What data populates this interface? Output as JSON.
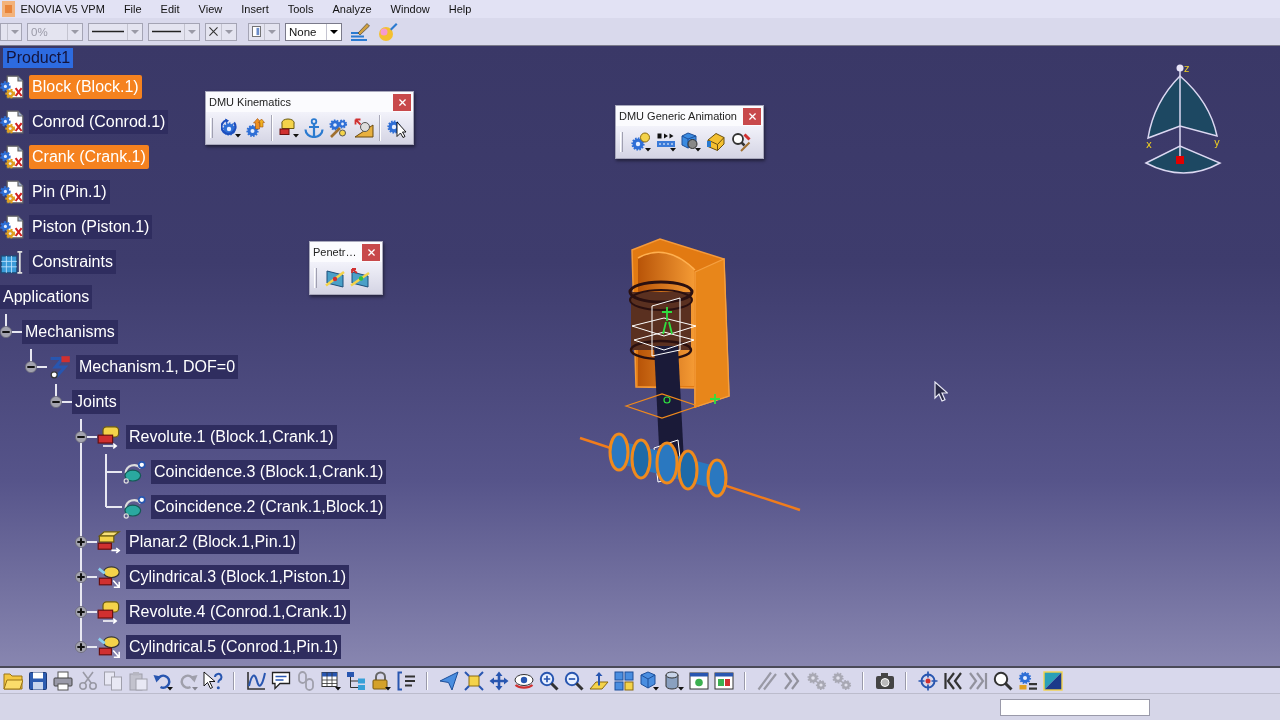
{
  "menu_bar": {
    "items": [
      "ENOVIA V5 VPM",
      "File",
      "Edit",
      "View",
      "Insert",
      "Tools",
      "Analyze",
      "Window",
      "Help"
    ]
  },
  "top_toolbar": {
    "dropdowns": [
      {
        "kind": "blank",
        "disabled": true
      },
      {
        "kind": "text",
        "value": "0%",
        "disabled": true
      },
      {
        "kind": "line",
        "disabled": true
      },
      {
        "kind": "line",
        "disabled": true
      },
      {
        "kind": "cross",
        "disabled": true
      },
      {
        "kind": "page",
        "disabled": true
      },
      {
        "kind": "text",
        "value": "None",
        "disabled": false
      }
    ]
  },
  "tree": {
    "root": {
      "label": "Product1",
      "active": true
    },
    "items": [
      {
        "label": "Block (Block.1)",
        "kind": "part",
        "selected": true
      },
      {
        "label": "Conrod (Conrod.1)",
        "kind": "part",
        "selected": false
      },
      {
        "label": "Crank (Crank.1)",
        "kind": "part",
        "selected": true
      },
      {
        "label": "Pin (Pin.1)",
        "kind": "part",
        "selected": false
      },
      {
        "label": "Piston (Piston.1)",
        "kind": "part",
        "selected": false
      },
      {
        "label": "Constraints",
        "kind": "constraints",
        "selected": false
      },
      {
        "label": "Applications",
        "selected": false,
        "children": [
          {
            "label": "Mechanisms",
            "selected": false,
            "expanded": true,
            "children": [
              {
                "label": "Mechanism.1, DOF=0",
                "kind": "mechanism",
                "selected": false,
                "expanded": true,
                "children": [
                  {
                    "label": "Joints",
                    "selected": false,
                    "expanded": true,
                    "children": [
                      {
                        "label": "Revolute.1 (Block.1,Crank.1)",
                        "kind": "revolute",
                        "selected": false,
                        "expanded": true,
                        "children": [
                          {
                            "label": "Coincidence.3 (Block.1,Crank.1)",
                            "kind": "coincidence",
                            "selected": false
                          },
                          {
                            "label": "Coincidence.2 (Crank.1,Block.1)",
                            "kind": "coincidence",
                            "selected": false
                          }
                        ]
                      },
                      {
                        "label": "Planar.2 (Block.1,Pin.1)",
                        "kind": "planar",
                        "selected": false,
                        "expanded": false
                      },
                      {
                        "label": "Cylindrical.3 (Block.1,Piston.1)",
                        "kind": "cylindrical",
                        "selected": false,
                        "expanded": false
                      },
                      {
                        "label": "Revolute.4 (Conrod.1,Crank.1)",
                        "kind": "revolute",
                        "selected": false,
                        "expanded": false
                      },
                      {
                        "label": "Cylindrical.5 (Conrod.1,Pin.1)",
                        "kind": "cylindrical",
                        "selected": false,
                        "expanded": false
                      }
                    ]
                  }
                ]
              }
            ]
          }
        ]
      }
    ]
  },
  "floating_toolbars": [
    {
      "title": "DMU Kinematics"
    },
    {
      "title": "DMU Generic Animation"
    },
    {
      "title": "Penetr…"
    }
  ],
  "compass": {
    "axis_labels": [
      "x",
      "y",
      "z"
    ]
  },
  "bottom_toolbar": {
    "groups": [
      {
        "tools": [
          {
            "disabled": false
          },
          {
            "disabled": false
          },
          {
            "disabled": false
          },
          {
            "disabled": true
          },
          {
            "disabled": true
          },
          {
            "disabled": true
          },
          {
            "disabled": false
          },
          {
            "disabled": true
          },
          {
            "disabled": false
          }
        ]
      },
      {
        "tools": [
          {
            "disabled": false
          },
          {
            "disabled": false
          },
          {
            "disabled": true
          },
          {
            "disabled": false
          },
          {
            "disabled": false
          },
          {
            "disabled": false
          },
          {
            "disabled": false
          }
        ]
      },
      {
        "tools": [
          {
            "disabled": false
          },
          {
            "disabled": false
          },
          {
            "disabled": false
          },
          {
            "disabled": false
          },
          {
            "disabled": false
          },
          {
            "disabled": false
          },
          {
            "disabled": false
          },
          {
            "disabled": false
          },
          {
            "disabled": false
          },
          {
            "disabled": false
          },
          {
            "disabled": false
          },
          {
            "disabled": false
          }
        ]
      },
      {
        "tools": [
          {
            "disabled": true
          },
          {
            "disabled": true
          },
          {
            "disabled": true
          },
          {
            "disabled": true
          }
        ]
      },
      {
        "tools": [
          {
            "disabled": false
          }
        ]
      },
      {
        "tools": [
          {
            "disabled": false
          },
          {
            "disabled": false
          },
          {
            "disabled": true
          },
          {
            "disabled": false
          },
          {
            "disabled": false
          },
          {
            "disabled": false
          }
        ]
      }
    ]
  }
}
